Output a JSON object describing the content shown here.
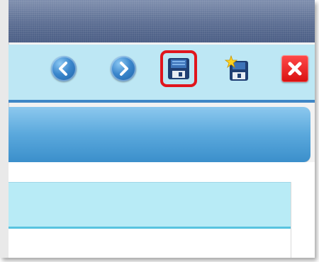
{
  "window": {
    "title": ""
  },
  "toolbar": {
    "buttons": [
      {
        "name": "back",
        "icon": "chevron-left-icon"
      },
      {
        "name": "forward",
        "icon": "chevron-right-icon"
      },
      {
        "name": "save",
        "icon": "floppy-disk-icon",
        "highlighted": true
      },
      {
        "name": "save-as",
        "icon": "floppy-disk-star-icon"
      },
      {
        "name": "close",
        "icon": "close-icon"
      }
    ]
  },
  "colors": {
    "toolbar_bg": "#bde7f4",
    "accent_blue": "#3f86c6",
    "highlight_red": "#e0161d",
    "close_red": "#e11616"
  }
}
